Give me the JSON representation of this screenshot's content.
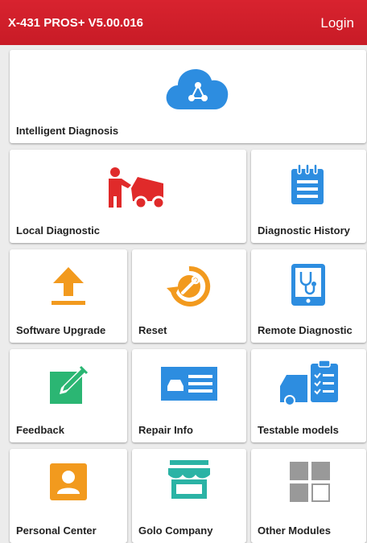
{
  "header": {
    "title": "X-431 PROS+ V5.00.016",
    "login_label": "Login"
  },
  "tiles": {
    "intelligent_diagnosis": {
      "label": "Intelligent Diagnosis",
      "icon": "cloud-share-icon",
      "color": "#2d8de0"
    },
    "local_diagnostic": {
      "label": "Local Diagnostic",
      "icon": "mechanic-car-icon",
      "color": "#e02a2a"
    },
    "diagnostic_history": {
      "label": "Diagnostic History",
      "icon": "notepad-icon",
      "color": "#2d8de0"
    },
    "software_upgrade": {
      "label": "Software Upgrade",
      "icon": "upload-arrow-icon",
      "color": "#f29a1e"
    },
    "reset": {
      "label": "Reset",
      "icon": "wrench-reset-icon",
      "color": "#f29a1e"
    },
    "remote_diagnostic": {
      "label": "Remote Diagnostic",
      "icon": "stethoscope-tablet-icon",
      "color": "#2d8de0"
    },
    "feedback": {
      "label": "Feedback",
      "icon": "edit-pencil-icon",
      "color": "#2bb673"
    },
    "repair_info": {
      "label": "Repair Info",
      "icon": "car-document-icon",
      "color": "#2d8de0"
    },
    "testable_models": {
      "label": "Testable models",
      "icon": "car-checklist-icon",
      "color": "#2d8de0"
    },
    "personal_center": {
      "label": "Personal Center",
      "icon": "user-card-icon",
      "color": "#f29a1e"
    },
    "golo_company": {
      "label": "Golo Company",
      "icon": "storefront-icon",
      "color": "#2bb3a5"
    },
    "other_modules": {
      "label": "Other Modules",
      "icon": "grid-modules-icon",
      "color": "#999999"
    }
  }
}
